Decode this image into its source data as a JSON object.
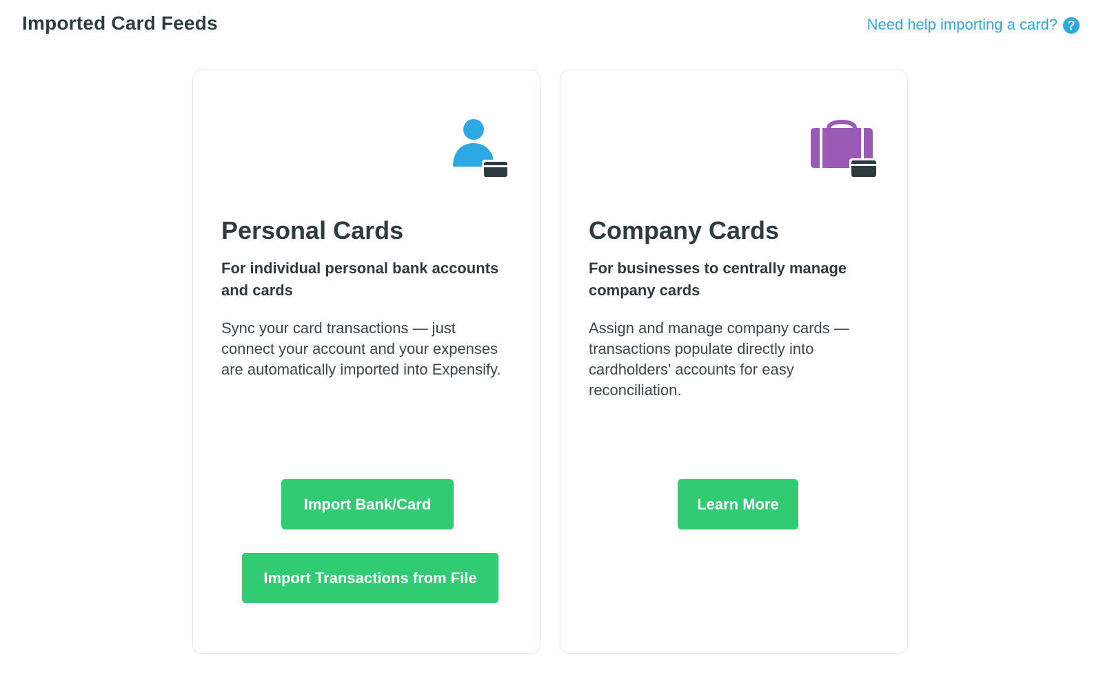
{
  "header": {
    "title": "Imported Card Feeds",
    "help_link": "Need help importing a card?",
    "help_icon_glyph": "?"
  },
  "cards": {
    "personal": {
      "icon": "person-card-icon",
      "icon_color": "#2ea8e1",
      "title": "Personal Cards",
      "subtitle": "For individual personal bank accounts and cards",
      "description": "Sync your card transactions — just connect your account and your expenses are automatically imported into Expensify.",
      "buttons": {
        "import_bank": "Import Bank/Card",
        "import_file": "Import Transactions from File"
      }
    },
    "company": {
      "icon": "briefcase-card-icon",
      "icon_color": "#9b59b6",
      "title": "Company Cards",
      "subtitle": "For businesses to centrally manage company cards",
      "description": "Assign and manage company cards — transactions populate directly into cardholders' accounts for easy reconciliation.",
      "buttons": {
        "learn_more": "Learn More"
      }
    }
  },
  "colors": {
    "accent_green": "#31cb74",
    "link_blue": "#2ea8e1",
    "text_dark": "#2e3b40",
    "card_border": "#e3e7ea"
  }
}
